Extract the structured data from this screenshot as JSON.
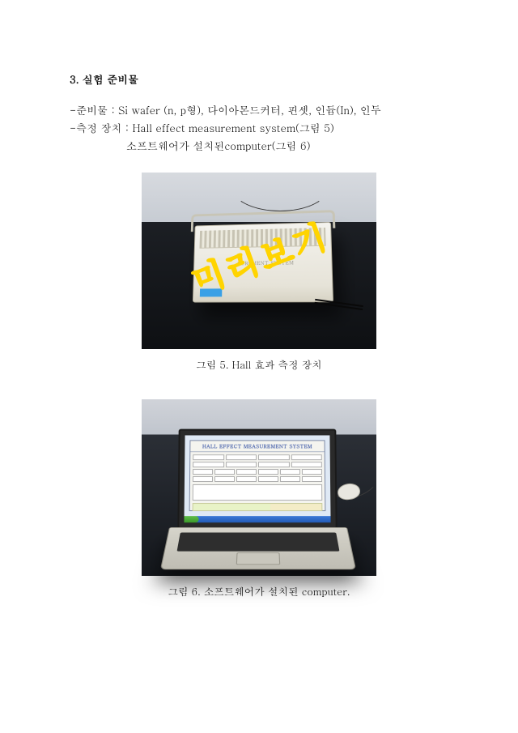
{
  "section": {
    "number": "3.",
    "title": "실험 준비물"
  },
  "lines": {
    "materials_label": "-준비물 : ",
    "materials_value": "Si wafer (n, p형), 다이아몬드커터, 핀셋, 인듐(In), 인두",
    "apparatus_label": "-측정 장치 : ",
    "apparatus_value_1": "Hall effect measurement system(그림 5)",
    "apparatus_value_2": "소프트웨어가 설치된computer(그림 6)"
  },
  "figure1": {
    "device_text": "SUREMENT SYSTEM",
    "caption": "그림 5. Hall 효과 측정 장치"
  },
  "figure2": {
    "app_title": "HALL EFFECT MEASUREMENT SYSTEM",
    "caption": "그림 6. 소프트웨어가 설치된 computer."
  },
  "watermark": "미리보기"
}
